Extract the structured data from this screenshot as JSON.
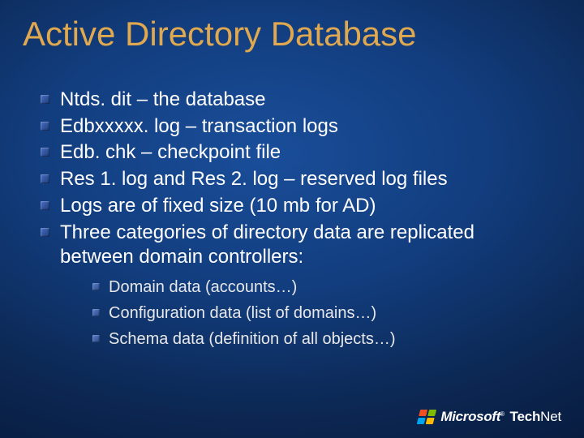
{
  "title": "Active Directory Database",
  "bullets": [
    "Ntds. dit – the database",
    "Edbxxxxx. log – transaction logs",
    "Edb. chk – checkpoint file",
    "Res 1. log and Res 2. log – reserved log files",
    "Logs are of fixed size  (10 mb for AD)",
    "Three categories of directory data are replicated between domain controllers:"
  ],
  "sub_bullets": [
    "Domain data (accounts…)",
    "Configuration data (list of domains…)",
    "Schema data (definition of all objects…)"
  ],
  "footer": {
    "brand": "Microsoft",
    "reg": "®",
    "product_bold": "Tech",
    "product_rest": "Net"
  }
}
